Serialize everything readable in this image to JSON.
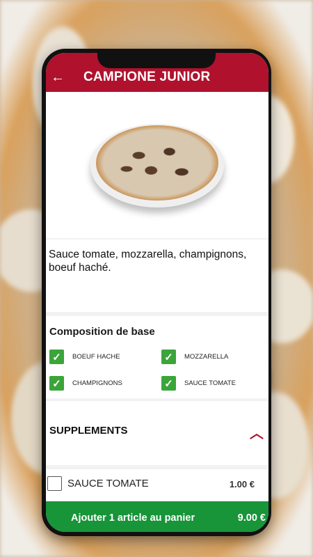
{
  "app": {
    "title": "CAMPIONE JUNIOR"
  },
  "header": {
    "back_icon": "arrow-left-icon"
  },
  "product": {
    "description": "Sauce tomate, mozzarella, champignons, boeuf haché."
  },
  "composition": {
    "title": "Composition de base",
    "items": [
      {
        "label": "BOEUF HACHE",
        "checked": true
      },
      {
        "label": "MOZZARELLA",
        "checked": true
      },
      {
        "label": "CHAMPIGNONS",
        "checked": true
      },
      {
        "label": "SAUCE TOMATE",
        "checked": true
      }
    ]
  },
  "supplements": {
    "title": "SUPPLEMENTS",
    "toggle_icon": "chevron-up-icon",
    "items": [
      {
        "label": "SAUCE TOMATE",
        "price": "1.00 €",
        "checked": false
      }
    ]
  },
  "cart": {
    "label": "Ajouter 1 article au panier",
    "price": "9.00 €"
  },
  "colors": {
    "appbar": "#b0122d",
    "check": "#3ba53a",
    "cta": "#189439"
  }
}
